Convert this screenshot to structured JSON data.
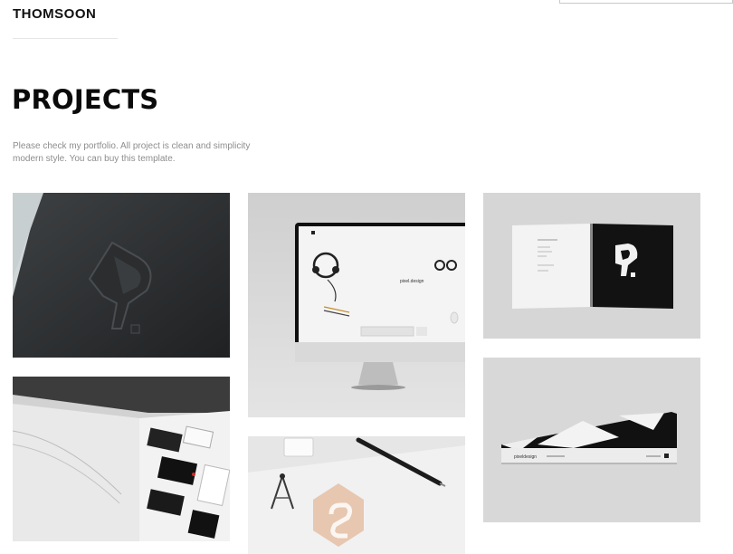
{
  "brand": {
    "name": "THOMSOON"
  },
  "page": {
    "title": "PROJECTS",
    "intro": "Please check my portfolio. All project is clean and simplicity modern style. You can buy this template."
  },
  "projects": [
    {
      "image": "embossed-logo-card"
    },
    {
      "image": "imac-mockup",
      "screen_text": "pixel.design"
    },
    {
      "image": "open-book-logo"
    },
    {
      "image": "open-book-stationery"
    },
    {
      "image": "drafting-tools"
    },
    {
      "image": "closed-book",
      "spine_text": "pixeldesign"
    }
  ]
}
